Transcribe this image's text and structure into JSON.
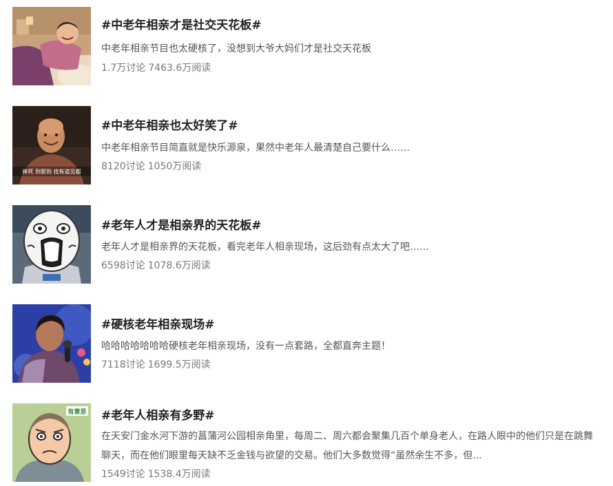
{
  "topics": [
    {
      "title": "#中老年相亲才是社交天花板#",
      "desc": "中老年相亲节目也太硬核了，没想到大爷大妈们才是社交天花板",
      "discussions": "1.7万讨论",
      "reads": "7463.6万阅读",
      "thumb_icon": "laughing-woman-photo"
    },
    {
      "title": "#中老年相亲也太好笑了#",
      "desc": "中老年相亲节目简直就是快乐源泉，果然中老年人最清楚自己要什么……",
      "discussions": "8120讨论",
      "reads": "1050万阅读",
      "thumb_icon": "bald-man-photo",
      "thumb_caption": "摔死 到那到 找有道见都"
    },
    {
      "title": "#老年人才是相亲界的天花板#",
      "desc": "老年人才是相亲界的天花板，看完老年人相亲现场，这后劲有点太大了吧……",
      "discussions": "6598讨论",
      "reads": "1078.6万阅读",
      "thumb_icon": "shocked-mascot-photo"
    },
    {
      "title": "#硬核老年相亲现场#",
      "desc": "哈哈哈哈哈哈哈硬核老年相亲现场，没有一点套路，全都直奔主题！",
      "discussions": "7118讨论",
      "reads": "1699.5万阅读",
      "thumb_icon": "woman-with-microphone-photo"
    },
    {
      "title": "#老年人相亲有多野#",
      "desc": "在天安门金水河下游的菖蒲河公园相亲角里，每周二、周六都会聚集几百个单身老人，在路人眼中的他们只是在跳舞聊天，而在他们眼里每天缺不乏金钱与欲望的交易。他们大多数觉得“虽然余生不多，但...",
      "discussions": "1549讨论",
      "reads": "1538.4万阅读",
      "thumb_icon": "cartoon-old-man-illustration",
      "thumb_badge": "有意思"
    }
  ],
  "colors": {
    "title": "#222222",
    "desc": "#555555",
    "stats": "#777777"
  }
}
